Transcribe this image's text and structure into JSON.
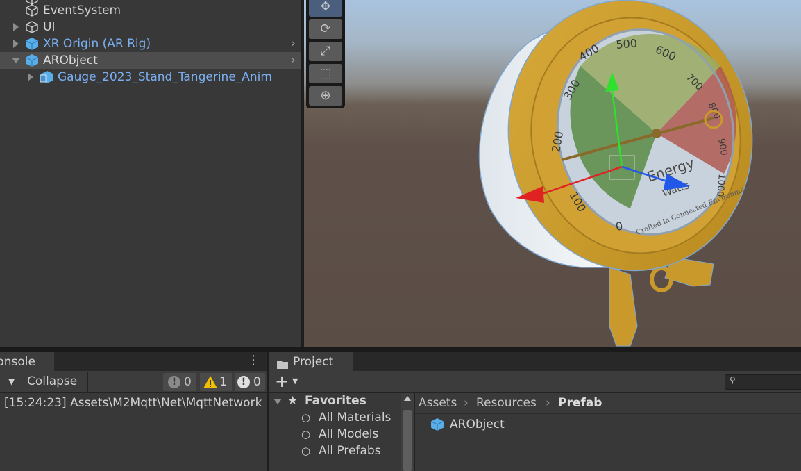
{
  "hierarchy": {
    "items": [
      {
        "label": "EventSystem"
      },
      {
        "label": "UI"
      },
      {
        "label": "XR Origin (AR Rig)"
      },
      {
        "label": "ARObject"
      },
      {
        "label": "Gauge_2023_Stand_Tangerine_Anim"
      }
    ]
  },
  "scene": {
    "gauge": {
      "ticks": [
        "0",
        "100",
        "200",
        "300",
        "400",
        "500",
        "600",
        "700",
        "800",
        "900",
        "1000"
      ],
      "title": "Energy",
      "unit": "Watts",
      "caption": "Crafted in Connected Environments"
    }
  },
  "console": {
    "tab": "Console",
    "collapse": "Collapse",
    "errors": "0",
    "warnings": "1",
    "messages": "0",
    "log": "[15:24:23] Assets\\M2Mqtt\\Net\\MqttNetwork"
  },
  "project": {
    "tab": "Project",
    "favorites": {
      "title": "Favorites",
      "items": [
        "All Materials",
        "All Models",
        "All Prefabs"
      ]
    },
    "breadcrumb": [
      "Assets",
      "Resources",
      "Prefab"
    ],
    "assets": [
      {
        "label": "ARObject"
      }
    ]
  },
  "colors": {
    "accent": "#7bb0f2",
    "panel": "#383838"
  }
}
